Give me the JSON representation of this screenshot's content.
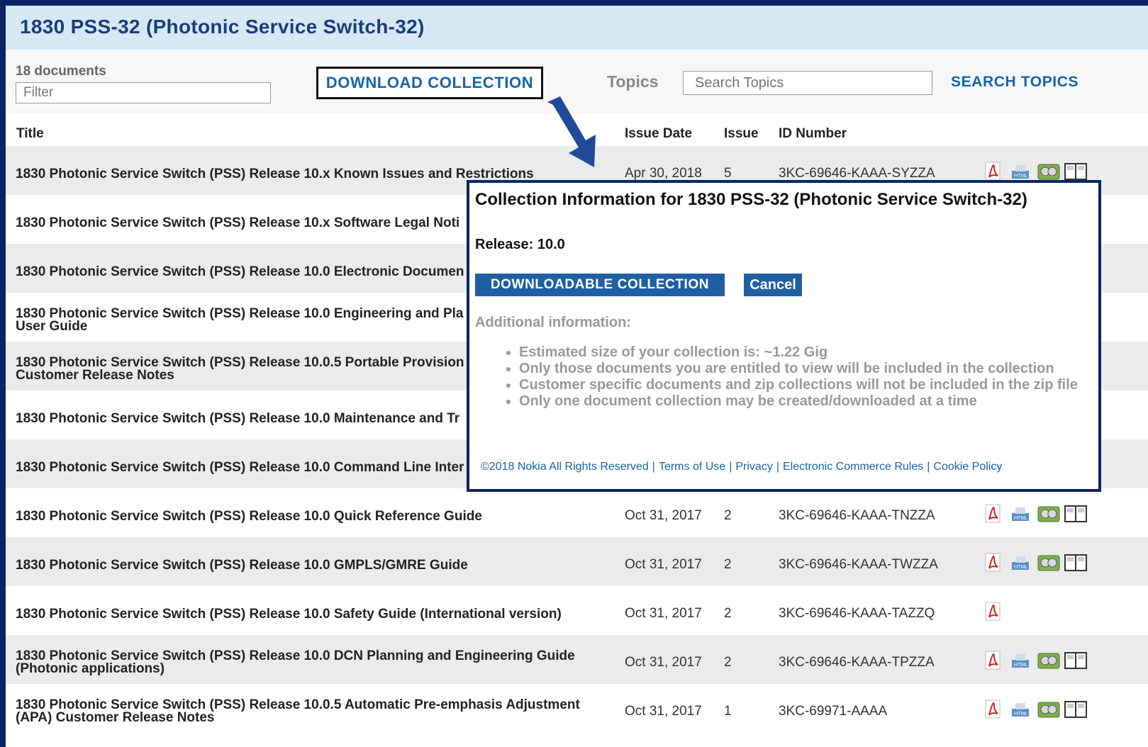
{
  "header": {
    "title": "1830 PSS-32 (Photonic Service Switch-32)"
  },
  "toolbar": {
    "doc_count": "18 documents",
    "filter_placeholder": "Filter",
    "download_label": "DOWNLOAD COLLECTION",
    "topics_label": "Topics",
    "topics_placeholder": "Search Topics",
    "search_topics_label": "SEARCH TOPICS"
  },
  "columns": {
    "title": "Title",
    "issue_date": "Issue Date",
    "issue": "Issue",
    "id_number": "ID Number"
  },
  "rows": [
    {
      "title": "1830 Photonic Service Switch (PSS) Release 10.x Known Issues and Restrictions",
      "title2": "",
      "date": "Apr 30, 2018",
      "issue": "5",
      "id": "3KC-69646-KAAA-SYZZA",
      "icons": [
        "pdf-icon",
        "html-icon",
        "zip-icon",
        "book-icon"
      ]
    },
    {
      "title": "1830 Photonic Service Switch (PSS) Release 10.x Software Legal Noti",
      "title2": "",
      "date": "",
      "issue": "",
      "id": "",
      "icons": []
    },
    {
      "title": "1830 Photonic Service Switch (PSS) Release 10.0 Electronic Documen",
      "title2": "",
      "date": "",
      "issue": "",
      "id": "",
      "icons": []
    },
    {
      "title": "1830 Photonic Service Switch (PSS) Release 10.0 Engineering and Pla",
      "title2": "User Guide",
      "date": "",
      "issue": "",
      "id": "",
      "icons": []
    },
    {
      "title": "1830 Photonic Service Switch (PSS) Release 10.0.5 Portable Provision",
      "title2": "Customer Release Notes",
      "date": "",
      "issue": "",
      "id": "",
      "icons": []
    },
    {
      "title": "1830 Photonic Service Switch (PSS) Release 10.0 Maintenance and Tr",
      "title2": "",
      "date": "",
      "issue": "",
      "id": "",
      "icons": []
    },
    {
      "title": "1830 Photonic Service Switch (PSS) Release 10.0 Command Line Inter",
      "title2": "",
      "date": "",
      "issue": "",
      "id": "",
      "icons": []
    },
    {
      "title": "1830 Photonic Service Switch (PSS) Release 10.0 Quick Reference Guide",
      "title2": "",
      "date": "Oct 31, 2017",
      "issue": "2",
      "id": "3KC-69646-KAAA-TNZZA",
      "icons": [
        "pdf-icon",
        "html-icon",
        "zip-icon",
        "book-icon"
      ]
    },
    {
      "title": "1830 Photonic Service Switch (PSS) Release 10.0 GMPLS/GMRE Guide",
      "title2": "",
      "date": "Oct 31, 2017",
      "issue": "2",
      "id": "3KC-69646-KAAA-TWZZA",
      "icons": [
        "pdf-icon",
        "html-icon",
        "zip-icon",
        "book-icon"
      ]
    },
    {
      "title": "1830 Photonic Service Switch (PSS) Release 10.0 Safety Guide (International version)",
      "title2": "",
      "date": "Oct 31, 2017",
      "issue": "2",
      "id": "3KC-69646-KAAA-TAZZQ",
      "icons": [
        "pdf-icon"
      ]
    },
    {
      "title": "1830 Photonic Service Switch (PSS) Release 10.0 DCN Planning and Engineering Guide",
      "title2": "(Photonic applications)",
      "date": "Oct 31, 2017",
      "issue": "2",
      "id": "3KC-69646-KAAA-TPZZA",
      "icons": [
        "pdf-icon",
        "html-icon",
        "zip-icon",
        "book-icon"
      ]
    },
    {
      "title": "1830 Photonic Service Switch (PSS) Release 10.0.5 Automatic Pre-emphasis Adjustment",
      "title2": "(APA) Customer Release Notes",
      "date": "Oct 31, 2017",
      "issue": "1",
      "id": "3KC-69971-AAAA",
      "icons": [
        "pdf-icon",
        "html-icon",
        "zip-icon",
        "book-icon"
      ]
    }
  ],
  "modal": {
    "title": "Collection Information for 1830 PSS-32 (Photonic Service Switch-32)",
    "release": "Release: 10.0",
    "download_label": "DOWNLOADABLE COLLECTION",
    "cancel_label": "Cancel",
    "additional_heading": "Additional information:",
    "bullets": [
      "Estimated size of your collection is: ~1.22 Gig",
      "Only those documents you are entitled to view will be included in the collection",
      "Customer specific documents and zip collections will not be included in the zip file",
      "Only one document collection may be created/downloaded at a time"
    ],
    "footer": {
      "copyright": "©2018 Nokia All Rights Reserved",
      "terms": "Terms of Use",
      "privacy": "Privacy",
      "ecommerce": "Electronic Commerce Rules",
      "cookie": "Cookie Policy"
    }
  },
  "colors": {
    "header_bg": "#d6e8f4",
    "title_blue": "#1a3d78",
    "link_blue": "#1664a8",
    "button_blue": "#1f5fa3",
    "frame_navy": "#0b2466"
  }
}
